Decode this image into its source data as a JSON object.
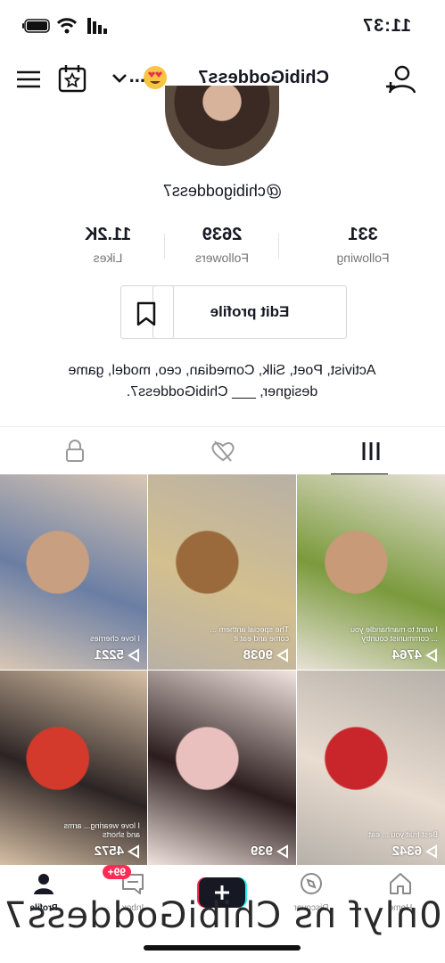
{
  "status_bar": {
    "time": "11:37"
  },
  "header": {
    "username": "ChibiGoddess7",
    "ellipsis": "..."
  },
  "profile": {
    "handle": "@chibigoddess7",
    "stats": [
      {
        "value": "331",
        "label": "Following"
      },
      {
        "value": "2639",
        "label": "Followers"
      },
      {
        "value": "11.2K",
        "label": "Likes"
      }
    ],
    "edit_label": "Edit profile",
    "bio_line1": "Activist, Poet, Silk, Comedian, ceo, model, game",
    "bio_line2": "designer, ___ ChibiGoddess7."
  },
  "tabs": [
    {
      "name": "videos",
      "icon": "grid-icon",
      "active": true
    },
    {
      "name": "liked",
      "icon": "heart-slash-icon",
      "active": false
    },
    {
      "name": "private",
      "icon": "lock-icon",
      "active": false
    }
  ],
  "videos": [
    {
      "views": "4764",
      "caption": "I want to manhandle you ... communist country",
      "colors": [
        "#c89a78",
        "#7a9a3c",
        "#e7e1d6"
      ]
    },
    {
      "views": "9038",
      "caption": "The special anthem ... come and eat it",
      "colors": [
        "#9b6a3c",
        "#d3c08f",
        "#b8b0a5"
      ]
    },
    {
      "views": "5221",
      "caption": "I love cherries",
      "colors": [
        "#c89f80",
        "#6a7ea4",
        "#d9c7b4"
      ]
    },
    {
      "views": "6342",
      "caption": "Best fruit you ... eat",
      "colors": [
        "#c9262b",
        "#e9dcd0",
        "#b5b0a9"
      ]
    },
    {
      "views": "939",
      "caption": "",
      "colors": [
        "#e9c0bd",
        "#2b1d1d",
        "#f2e4df"
      ]
    },
    {
      "views": "4572",
      "caption": "I love wearing... arms and shorts",
      "colors": [
        "#d33a2c",
        "#2c2424",
        "#d8c1a6"
      ]
    }
  ],
  "bottom_nav": [
    {
      "label": "Home",
      "icon": "home-icon"
    },
    {
      "label": "Discover",
      "icon": "compass-icon"
    },
    {
      "label": "",
      "icon": "plus-icon"
    },
    {
      "label": "Inbox",
      "icon": "inbox-icon"
    },
    {
      "label": "Profile",
      "icon": "person-icon"
    }
  ],
  "inbox_badge": "99+",
  "watermark": "0nlyf ns ChibiGoddess7",
  "colors": {
    "accent": "#fe2c55",
    "cyan": "#25f4ee",
    "text": "#161823"
  }
}
